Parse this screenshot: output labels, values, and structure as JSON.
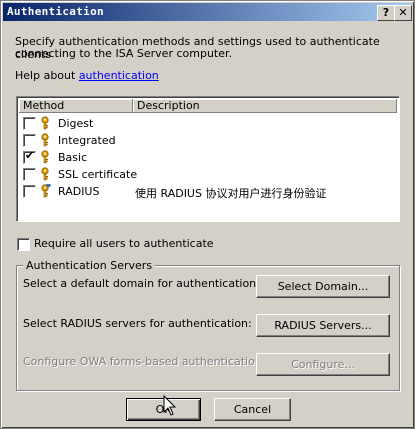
{
  "window": {
    "title": "Authentication"
  },
  "intro": {
    "line1": "Specify authentication methods and settings used to authenticate clients",
    "line2": "connecting to the ISA Server computer."
  },
  "help": {
    "prefix": "Help about",
    "link": "authentication"
  },
  "methods": {
    "columns": [
      "Method",
      "Description"
    ],
    "rows": [
      {
        "label": "Digest",
        "checked": false,
        "description": ""
      },
      {
        "label": "Integrated",
        "checked": false,
        "description": ""
      },
      {
        "label": "Basic",
        "checked": true,
        "description": ""
      },
      {
        "label": "SSL certificate",
        "checked": false,
        "description": ""
      },
      {
        "label": "RADIUS",
        "checked": false,
        "description": "使用 RADIUS 协议对用户进行身份验证"
      }
    ]
  },
  "require_all": {
    "label": "Require all users to authenticate",
    "checked": false
  },
  "servers": {
    "title": "Authentication Servers",
    "domain_label": "Select a default domain for authentication:",
    "domain_button": "Select Domain...",
    "radius_label": "Select RADIUS servers for authentication:",
    "radius_button": "RADIUS Servers...",
    "owa_label": "Configure OWA forms-based authentication:",
    "owa_button": "Configure..."
  },
  "footer": {
    "ok": "OK",
    "cancel": "Cancel"
  },
  "colors": {
    "face": "#d4d0c8",
    "title_start": "#0a246a",
    "title_end": "#a6caf0",
    "link": "#0000ff",
    "key": "#e0a000"
  }
}
